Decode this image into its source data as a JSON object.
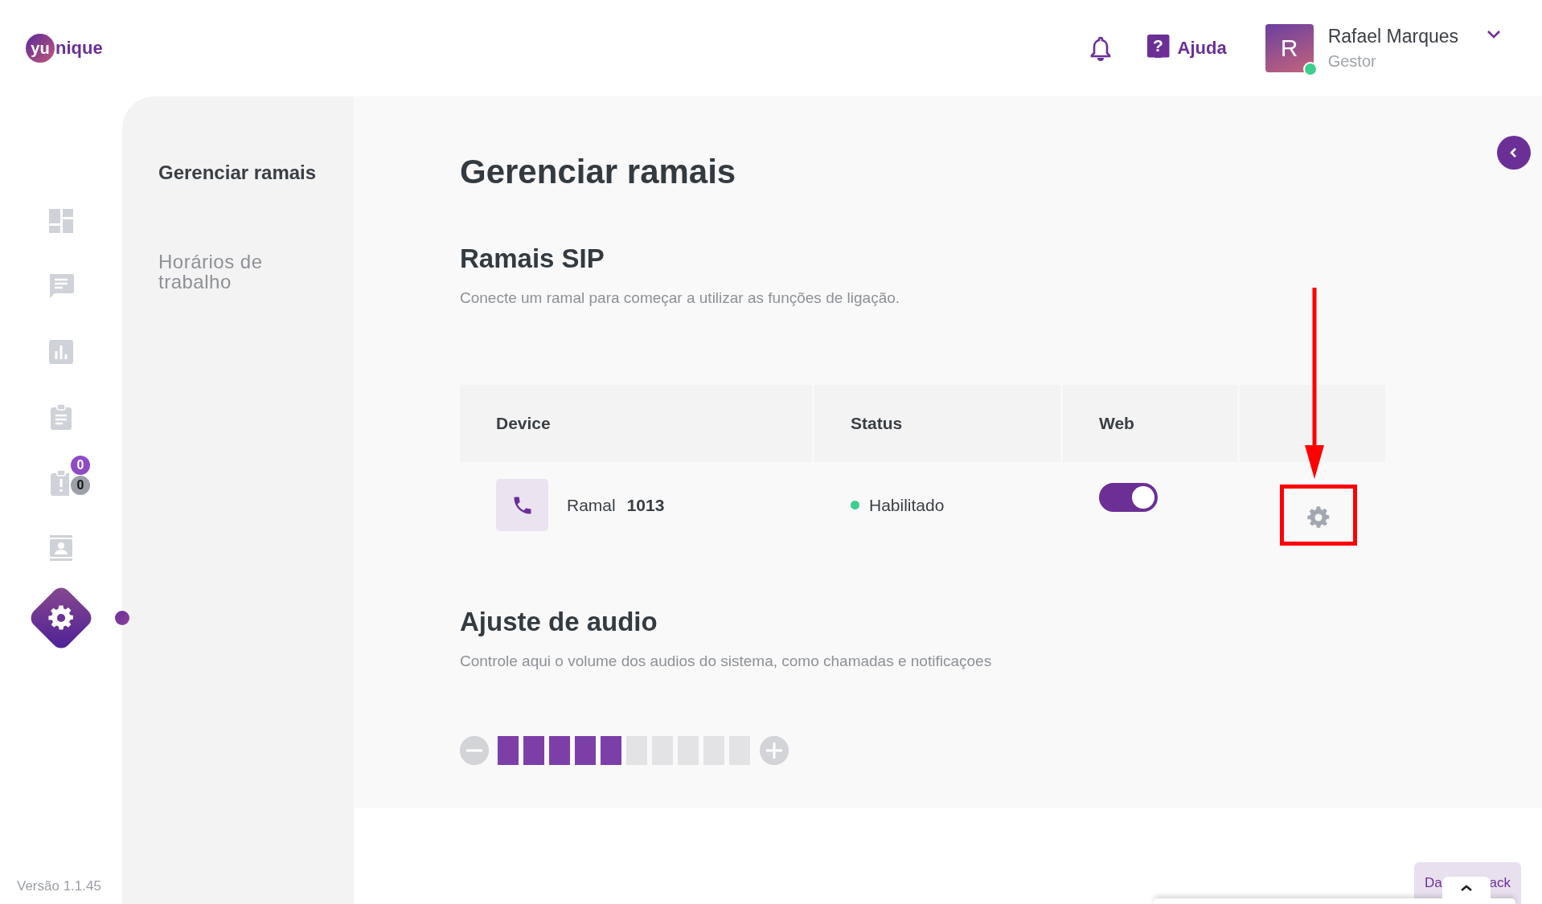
{
  "header": {
    "logo": {
      "prefix": "yu",
      "suffix": "nique"
    },
    "help_glyph": "?",
    "help_label": "Ajuda",
    "avatar_initial": "R",
    "user_online": true,
    "user_name": "Rafael Marques",
    "user_role": "Gestor"
  },
  "rail": [
    {
      "kind": "dashboard",
      "selected": false
    },
    {
      "kind": "chat",
      "selected": false
    },
    {
      "kind": "chart",
      "selected": false
    },
    {
      "kind": "clipboard",
      "selected": false
    },
    {
      "kind": "alert",
      "selected": false,
      "badges": [
        "0",
        "0"
      ]
    },
    {
      "kind": "contacts",
      "selected": false
    },
    {
      "kind": "settings",
      "selected": true
    }
  ],
  "version": "Versão 1.1.45",
  "submenu": [
    {
      "label": "Gerenciar ramais",
      "selected": true
    },
    {
      "label": "Horários de trabalho",
      "selected": false
    }
  ],
  "page_title": "Gerenciar ramais",
  "sip": {
    "title": "Ramais SIP",
    "description": "Conecte um ramal para começar a utilizar as funções de ligação.",
    "table": {
      "columns": [
        "Device",
        "Status",
        "Web"
      ],
      "rows": [
        {
          "device_label": "Ramal",
          "device_number": "1013",
          "status": "Habilitado",
          "web_on": true
        }
      ]
    }
  },
  "audio": {
    "title": "Ajuste de audio",
    "description": "Controle aqui o volume dos audios do sistema, como chamadas e notificaçoes",
    "volume": {
      "level": 0.5
    }
  },
  "feedback": {
    "text_left": "Da",
    "text_right": "ack"
  }
}
